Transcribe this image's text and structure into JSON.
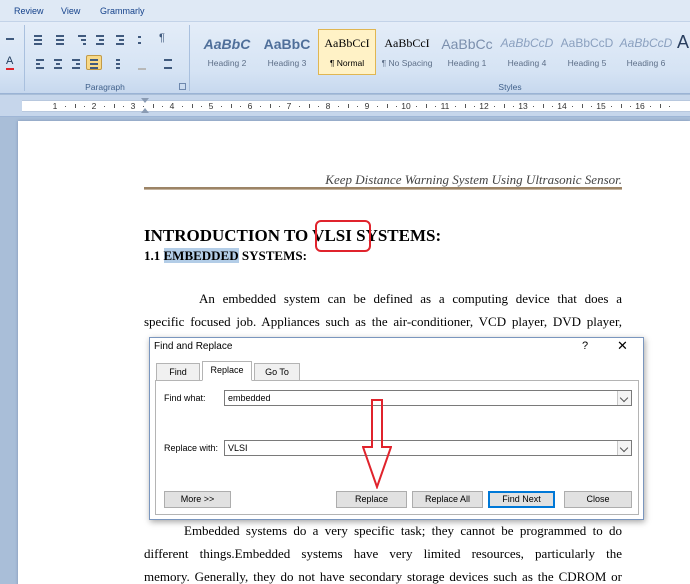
{
  "ribbon": {
    "tabs": [
      "Review",
      "View",
      "Grammarly"
    ],
    "paragraph_group_label": "Paragraph",
    "styles_group_label": "Styles",
    "styles": [
      {
        "sample": "AaBbC",
        "name": "Heading 2"
      },
      {
        "sample": "AaBbC",
        "name": "Heading 3"
      },
      {
        "sample": "AaBbCcI",
        "name": "¶ Normal"
      },
      {
        "sample": "AaBbCcI",
        "name": "¶ No Spacing"
      },
      {
        "sample": "AaBbCc",
        "name": "Heading 1"
      },
      {
        "sample": "AaBbCcD",
        "name": "Heading 4"
      },
      {
        "sample": "AaBbCcD",
        "name": "Heading 5"
      },
      {
        "sample": "AaBbCcD",
        "name": "Heading 6"
      },
      {
        "sample": "A",
        "name": ""
      }
    ]
  },
  "ruler": {
    "numbers": [
      "4",
      "1",
      "2",
      "3",
      "4",
      "5",
      "6",
      "7",
      "8",
      "9",
      "10",
      "11",
      "12",
      "13",
      "14",
      "15",
      "16"
    ]
  },
  "document": {
    "header": "Keep Distance Warning System Using Ultrasonic Sensor.",
    "heading1_before": "INTRODUCTION TO ",
    "heading1_word": "VLSI",
    "heading1_after": " SYSTEMS:",
    "heading2_number": "1.1 ",
    "heading2_highlight": "EMBEDDED",
    "heading2_rest": " SYSTEMS:",
    "para1_line1": "An embedded system can be defined as a computing device that does a",
    "para1_line2": "specific focused job. Appliances such as the air-conditioner, VCD player, DVD player,",
    "para2_line1": "Embedded systems do a very specific task; they cannot be programmed to do",
    "para2_line2": "different things.Embedded systems have very limited resources, particularly the",
    "para2_line3": "memory. Generally, they do not have secondary storage devices such as the CDROM or"
  },
  "dialog": {
    "title": "Find and Replace",
    "help": "?",
    "close": "✕",
    "tabs": [
      "Find",
      "Replace",
      "Go To"
    ],
    "active_tab": "Replace",
    "find_label": "Find what:",
    "find_value": "embedded",
    "replace_label": "Replace with:",
    "replace_value": "VLSI",
    "buttons": {
      "more": "More >>",
      "replace": "Replace",
      "replace_all": "Replace All",
      "find_next": "Find Next",
      "close": "Close"
    }
  },
  "colors": {
    "annotation_red": "#e0232c",
    "selection_highlight": "#b3cde7",
    "ribbon_background": "#dfe9f5"
  }
}
